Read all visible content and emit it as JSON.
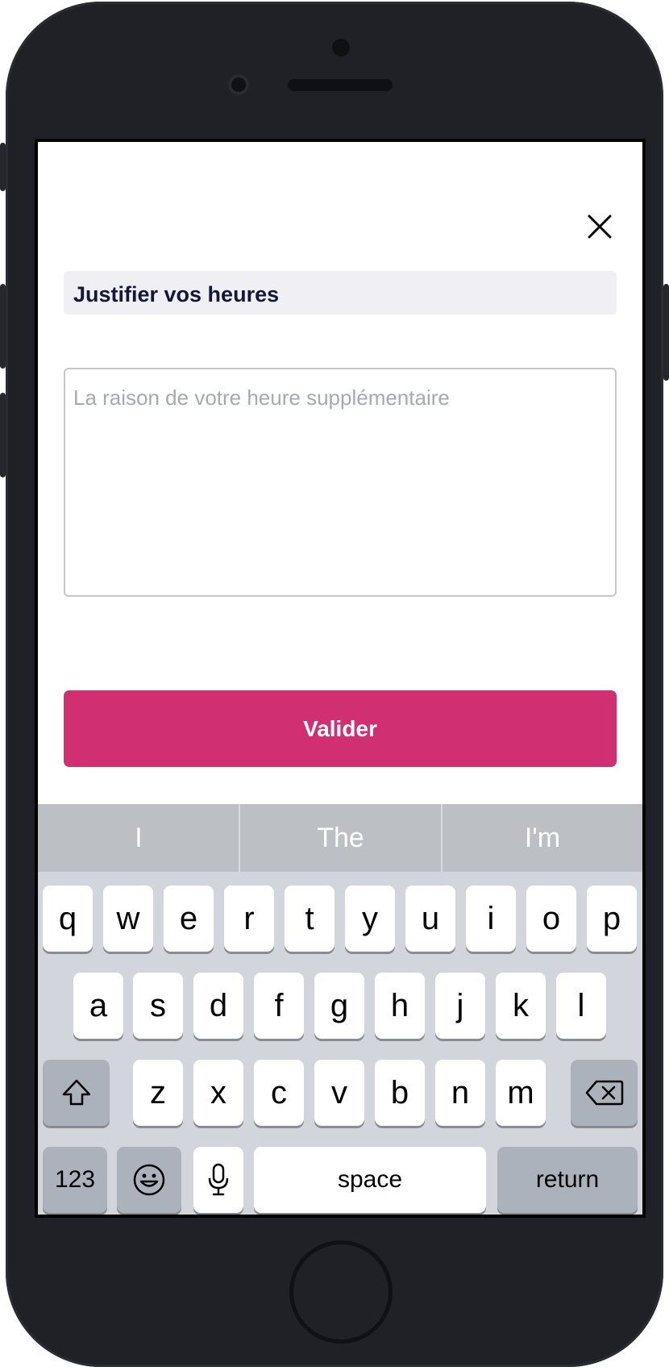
{
  "modal": {
    "close_icon": "close-icon",
    "title": "Justifier vos heures",
    "reason_placeholder": "La raison de votre heure supplémentaire",
    "submit_label": "Valider",
    "accent_color": "#d03071"
  },
  "keyboard": {
    "predictions": [
      "I",
      "The",
      "I'm"
    ],
    "row1": [
      "q",
      "w",
      "e",
      "r",
      "t",
      "y",
      "u",
      "i",
      "o",
      "p"
    ],
    "row2": [
      "a",
      "s",
      "d",
      "f",
      "g",
      "h",
      "j",
      "k",
      "l"
    ],
    "row3": [
      "z",
      "x",
      "c",
      "v",
      "b",
      "n",
      "m"
    ],
    "shift_icon": "shift-icon",
    "backspace_icon": "backspace-icon",
    "numbers_label": "123",
    "emoji_icon": "emoji-icon",
    "mic_icon": "microphone-icon",
    "space_label": "space",
    "return_label": "return"
  }
}
